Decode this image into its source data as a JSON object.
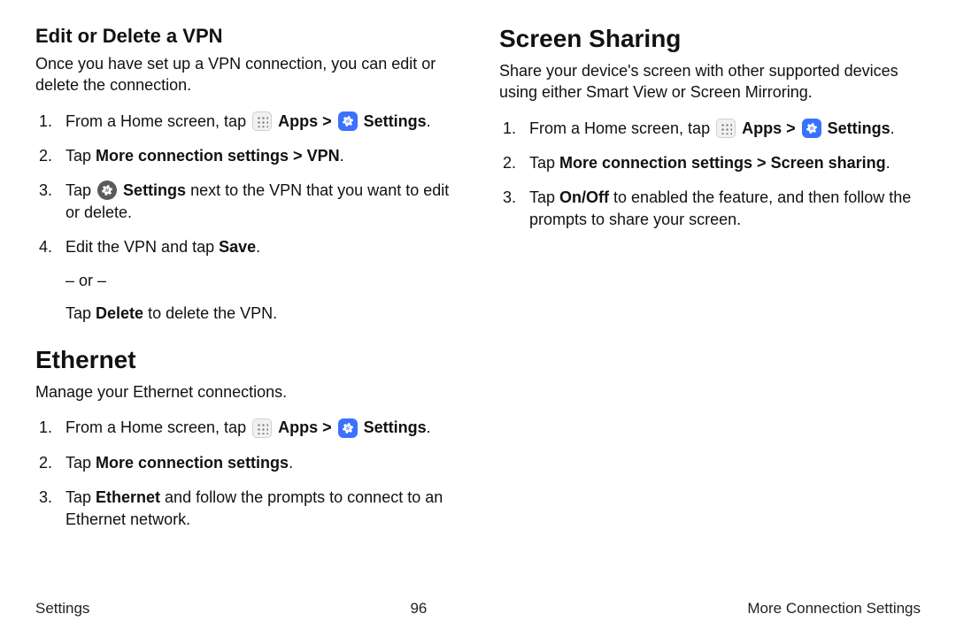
{
  "left": {
    "vpn": {
      "heading": "Edit or Delete a VPN",
      "intro": "Once you have set up a VPN connection, you can edit or delete the connection.",
      "step1_pre": "From a Home screen, tap ",
      "apps_label": "Apps",
      "sep": " > ",
      "settings_label": "Settings",
      "period": ".",
      "step2_pre": "Tap ",
      "step2_bold": "More connection settings > VPN",
      "step3_pre": "Tap ",
      "step3_bold": "Settings",
      "step3_post": " next to the VPN that you want to edit or delete.",
      "step4_pre": "Edit the VPN and tap ",
      "step4_bold": "Save",
      "step4_or": "– or –",
      "step4_alt_pre": "Tap ",
      "step4_alt_bold": "Delete",
      "step4_alt_post": " to delete the VPN."
    },
    "ethernet": {
      "heading": "Ethernet",
      "intro": "Manage your Ethernet connections.",
      "step1_pre": "From a Home screen, tap ",
      "apps_label": "Apps",
      "sep": " > ",
      "settings_label": "Settings",
      "period": ".",
      "step2_pre": "Tap ",
      "step2_bold": "More connection settings",
      "step3_pre": "Tap ",
      "step3_bold": "Ethernet",
      "step3_post": " and follow the prompts to connect to an Ethernet network."
    }
  },
  "right": {
    "sharing": {
      "heading": "Screen Sharing",
      "intro": "Share your device's screen with other supported devices using either Smart View or Screen Mirroring.",
      "step1_pre": "From a Home screen, tap ",
      "apps_label": "Apps",
      "sep": " > ",
      "settings_label": "Settings",
      "period": ".",
      "step2_pre": "Tap ",
      "step2_bold": "More connection settings > Screen sharing",
      "step3_pre": "Tap ",
      "step3_bold": "On/Off",
      "step3_post": " to enabled the feature, and then follow the prompts to share your screen."
    }
  },
  "footer": {
    "left": "Settings",
    "center": "96",
    "right": "More Connection Settings"
  }
}
